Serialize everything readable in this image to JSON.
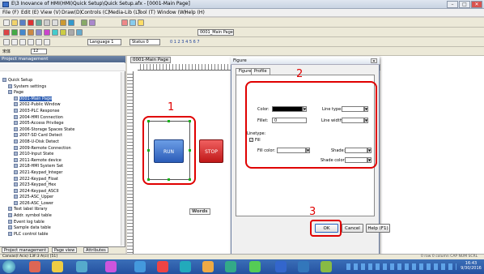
{
  "window": {
    "title": "E\\3 Inovance of HMI(HMI)Quick Setup\\Quick Setup.afx - [0001-Main Page]",
    "min": "–",
    "max": "□",
    "close": "✕"
  },
  "menu": [
    "File (F)",
    "Edit (E)",
    "View (V)",
    "Draw(D)",
    "Controls (C)",
    "Media-Lib (L)",
    "Tool (T)",
    "Window (W)",
    "Help (H)"
  ],
  "toolbar": {
    "page_select": "0001_Main Page",
    "language_select": "Language 1",
    "status_select": "Status 0",
    "number_row": "0  1  2  3  4  5  6  7",
    "font_size": "12"
  },
  "side_panel": {
    "header": "Project management",
    "tree": [
      {
        "label": "Quick Setup",
        "level": 0
      },
      {
        "label": "System settings",
        "level": 1
      },
      {
        "label": "Page",
        "level": 1
      },
      {
        "label": "0001-Main Page",
        "level": 2,
        "selected": true
      },
      {
        "label": "2002-Public Window",
        "level": 2
      },
      {
        "label": "2003-PLC Response",
        "level": 2
      },
      {
        "label": "2004-HMI Connection",
        "level": 2
      },
      {
        "label": "2005-Access Privilege",
        "level": 2
      },
      {
        "label": "2006-Storage Spaces State",
        "level": 2
      },
      {
        "label": "2007-SD Card Detect",
        "level": 2
      },
      {
        "label": "2008-U-Disk Detect",
        "level": 2
      },
      {
        "label": "2009-Remote Connection",
        "level": 2
      },
      {
        "label": "2010-Input State",
        "level": 2
      },
      {
        "label": "2011-Remote device",
        "level": 2
      },
      {
        "label": "2018-HMI System Set",
        "level": 2
      },
      {
        "label": "2021-Keypad_Integer",
        "level": 2
      },
      {
        "label": "2022-Keypad_Float",
        "level": 2
      },
      {
        "label": "2023-Keypad_Hex",
        "level": 2
      },
      {
        "label": "2024-Keypad_ASCII",
        "level": 2
      },
      {
        "label": "2025-ASC_Upper",
        "level": 2
      },
      {
        "label": "2026-ASC_Lower",
        "level": 2
      },
      {
        "label": "Text label library",
        "level": 1
      },
      {
        "label": "Addr. symbol table",
        "level": 1
      },
      {
        "label": "Event log table",
        "level": 1
      },
      {
        "label": "Sample data table",
        "level": 1
      },
      {
        "label": "PLC control table",
        "level": 1
      }
    ],
    "tabs": [
      "Project management",
      "Page view",
      "Attributes"
    ]
  },
  "canvas": {
    "doc_tab": "0001-Main Page",
    "run_label": "RUN",
    "stop_label": "STOP",
    "word_label": "Words"
  },
  "dialog": {
    "title": "Figure",
    "close": "✕",
    "tabs": [
      "Figure",
      "Profile"
    ],
    "color_label": "Color:",
    "fillet_label": "Fillet:",
    "fillet_value": "0",
    "line_type_label": "Line type:",
    "line_width_label": "Line width:",
    "linetype_section": "Linetype:",
    "fill_checkbox": "Fill",
    "fill_color_label": "Fill color:",
    "shade_label": "Shade:",
    "shade_color_label": "Shade color:",
    "ok": "OK",
    "cancel": "Cancel",
    "help": "Help (F1)"
  },
  "annotations": {
    "one": "1",
    "two": "2",
    "three": "3"
  },
  "status_bar": {
    "left": "Canvas(I Acis) 13F:3 A(ci) [51]",
    "right": "0 row 0 column CAP NUM SCRL"
  },
  "taskbar": {
    "time": "16:43",
    "date": "9/30/2016"
  },
  "colors": {
    "annotation": "#e00000",
    "handles": "#19b219",
    "run": "#2b5cb8",
    "stop": "#c01818"
  }
}
